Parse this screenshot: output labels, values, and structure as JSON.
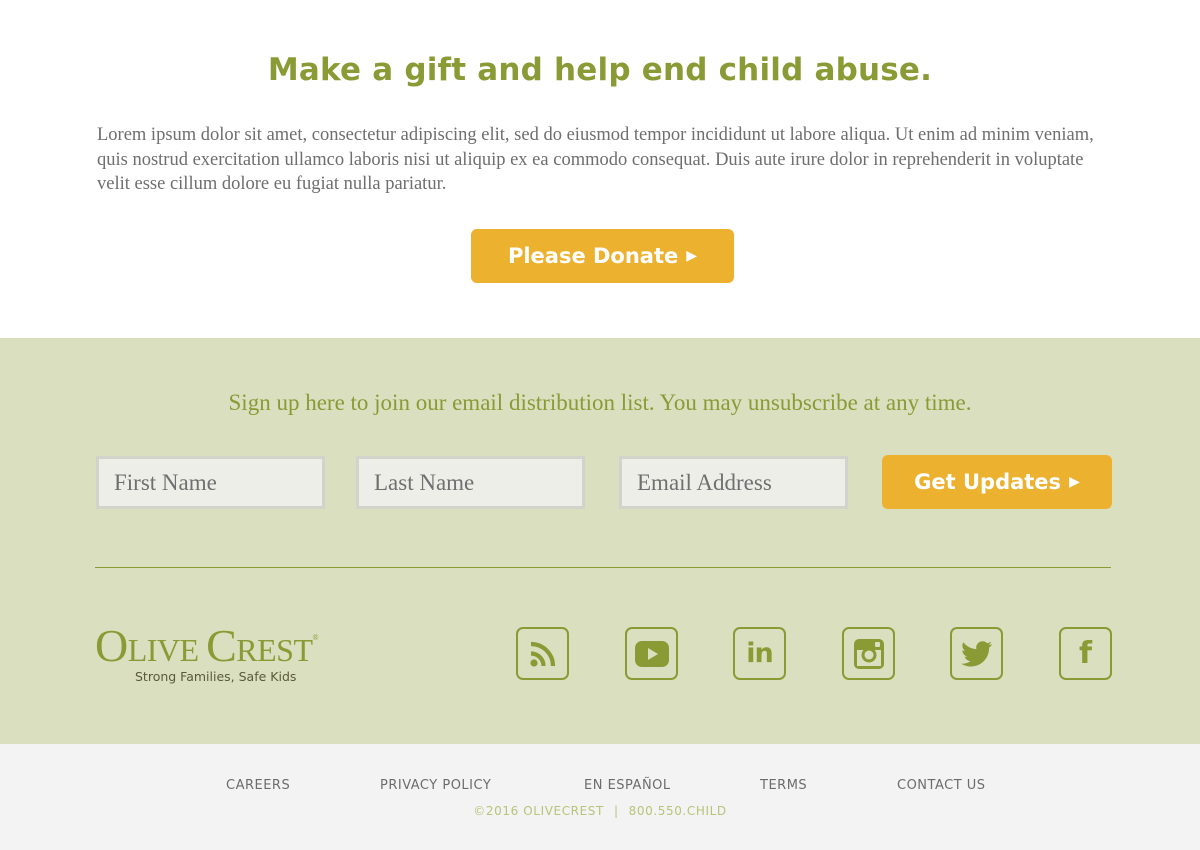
{
  "donate": {
    "title": "Make a gift and help end child abuse.",
    "body": "Lorem ipsum dolor sit amet, consectetur adipiscing elit, sed do eiusmod tempor incididunt ut labore aliqua. Ut enim ad minim veniam, quis nostrud exercitation ullamco laboris nisi ut aliquip ex ea commodo consequat. Duis aute irure dolor in reprehenderit in voluptate velit esse cillum dolore eu fugiat nulla pariatur.",
    "button_label": "Please Donate",
    "button_arrow": "▶"
  },
  "signup": {
    "text": "Sign up here to join our email distribution list. You may unsubscribe at any time.",
    "first_name_placeholder": "First Name",
    "last_name_placeholder": "Last Name",
    "email_placeholder": "Email Address",
    "first_name_value": "",
    "last_name_value": "",
    "email_value": "",
    "button_label": "Get Updates",
    "button_arrow": "▶"
  },
  "logo": {
    "first_initial": "O",
    "first_rest": "LIVE ",
    "second_initial": "C",
    "second_rest": "REST",
    "registered": "®",
    "tagline": "Strong Families, Safe Kids"
  },
  "social": [
    {
      "icon": "rss-icon"
    },
    {
      "icon": "youtube-icon"
    },
    {
      "icon": "linkedin-icon",
      "glyph": "in"
    },
    {
      "icon": "instagram-icon"
    },
    {
      "icon": "twitter-icon"
    },
    {
      "icon": "facebook-icon",
      "glyph": "f"
    }
  ],
  "footer": {
    "links": [
      "CAREERS",
      "PRIVACY POLICY",
      "EN ESPAÑOL",
      "TERMS",
      "CONTACT US"
    ],
    "copyright": "©2016 OLIVECREST",
    "separator": "|",
    "phone": "800.550.CHILD"
  },
  "colors": {
    "accent_green": "#8a9a35",
    "button_gold": "#ecb12f",
    "signup_bg": "#dadfbf",
    "footer_bg": "#f3f3f3"
  }
}
